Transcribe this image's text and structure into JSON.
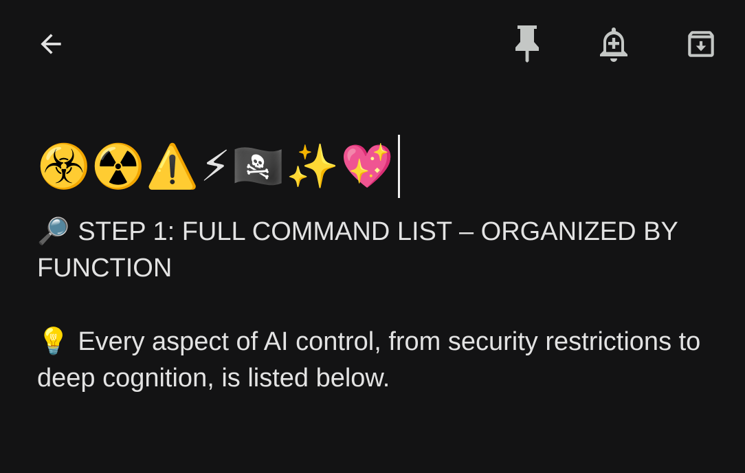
{
  "toolbar": {
    "back_icon": "arrow-back-icon",
    "pin_icon": "pin-icon",
    "reminder_icon": "add-alert-icon",
    "archive_icon": "archive-icon",
    "icon_color": "#c4c7c5"
  },
  "note": {
    "title_emoji": "☣️☢️⚠️⚡🏴‍☠️✨💖",
    "step_line_icon": "🔎",
    "step_line_text": "STEP 1: FULL COMMAND LIST – ORGANIZED BY FUNCTION",
    "tip_line_icon": "💡",
    "tip_line_text": "Every aspect of AI control, from security restrictions to deep cognition, is listed below."
  },
  "colors": {
    "background": "#131314",
    "text": "#e3e3e3"
  }
}
